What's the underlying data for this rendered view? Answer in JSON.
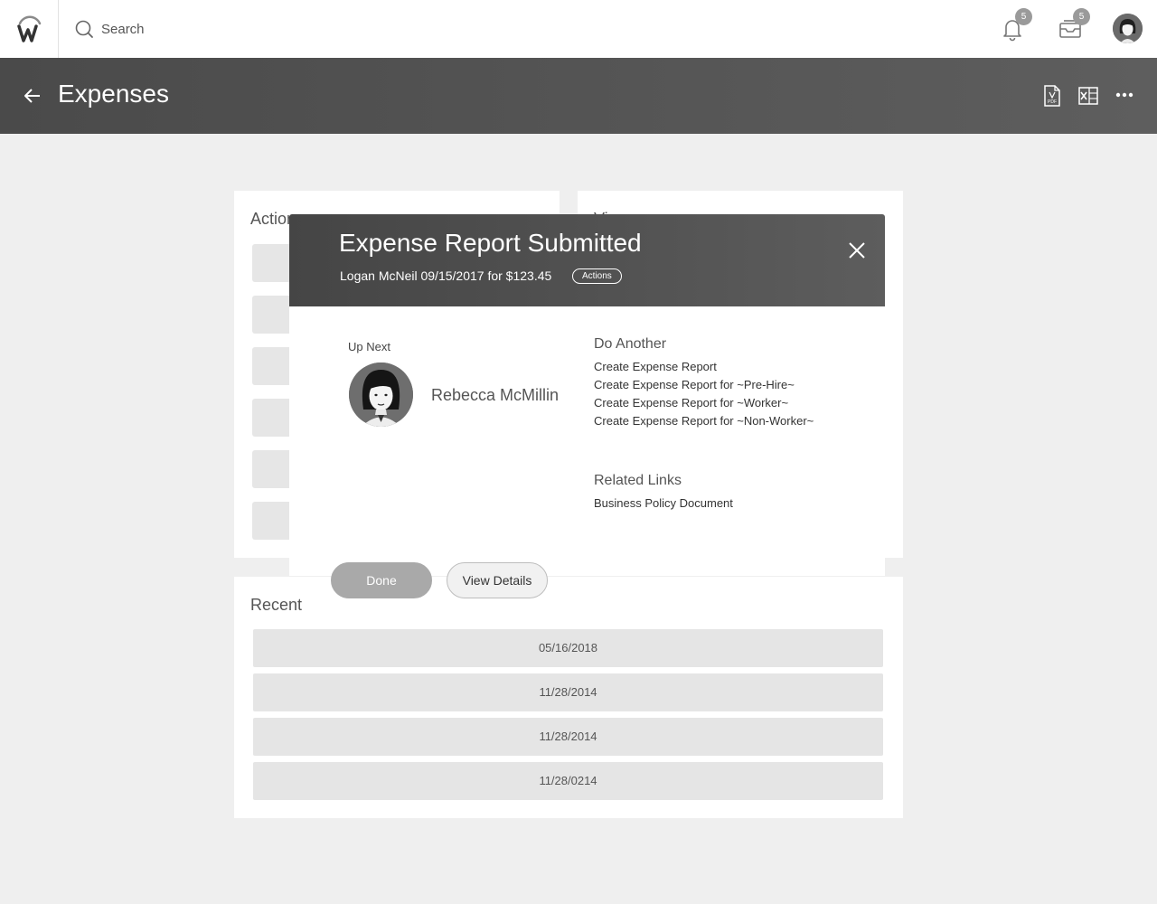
{
  "topbar": {
    "search_placeholder": "Search",
    "notifications_count": "5",
    "inbox_count": "5",
    "icons": [
      "workday-logo-icon",
      "search-icon",
      "bell-icon",
      "inbox-icon",
      "avatar"
    ]
  },
  "header": {
    "title": "Expenses",
    "icons": [
      "back-arrow-icon",
      "pdf-export-icon",
      "excel-export-icon",
      "more-options-icon"
    ]
  },
  "cards": {
    "actions_title": "Actions",
    "view_title": "View",
    "recent_title": "Recent",
    "recent_rows": [
      "05/16/2018",
      "11/28/2014",
      "11/28/2014",
      "11/28/0214"
    ]
  },
  "modal": {
    "title": "Expense Report Submitted",
    "subtitle": "Logan McNeil 09/15/2017 for $123.45",
    "actions_label": "Actions",
    "up_next_label": "Up Next",
    "up_next_name": "Rebecca McMillin",
    "do_another_title": "Do Another",
    "do_another_items": [
      "Create Expense Report",
      "Create Expense Report for ~Pre-Hire~",
      "Create Expense Report for ~Worker~",
      "Create Expense Report for ~Non-Worker~"
    ],
    "related_links_title": "Related Links",
    "related_links": [
      "Business Policy Document"
    ],
    "done_label": "Done",
    "view_details_label": "View Details"
  },
  "colors": {
    "header_bg": "#4a4a4a",
    "page_bg": "#efefef",
    "badge": "#9a9a9a",
    "done_button": "#a9a9a9"
  }
}
